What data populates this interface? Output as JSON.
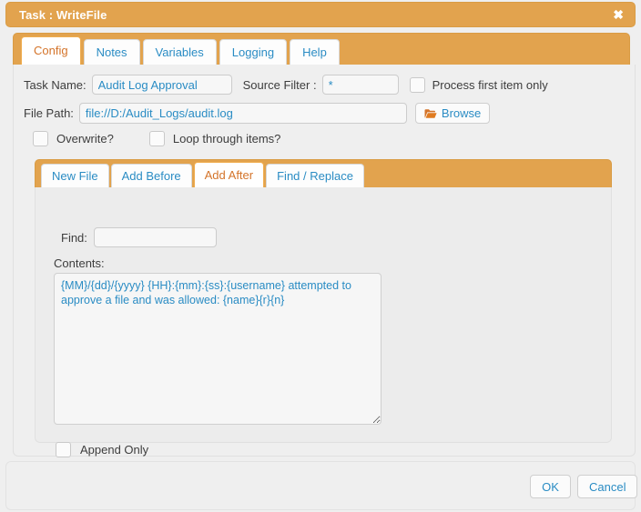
{
  "window": {
    "title": "Task : WriteFile",
    "close_icon": "close-icon",
    "close_glyph": "✖"
  },
  "main_tabs": [
    {
      "label": "Config",
      "active": true
    },
    {
      "label": "Notes",
      "active": false
    },
    {
      "label": "Variables",
      "active": false
    },
    {
      "label": "Logging",
      "active": false
    },
    {
      "label": "Help",
      "active": false
    }
  ],
  "config": {
    "task_name_label": "Task Name:",
    "task_name_value": "Audit Log Approval",
    "source_filter_label": "Source Filter :",
    "source_filter_value": "*",
    "process_first_item_label": "Process first item only",
    "process_first_item_checked": false,
    "file_path_label": "File Path:",
    "file_path_value": "file://D:/Audit_Logs/audit.log",
    "browse_label": "Browse",
    "browse_icon": "folder-open-icon",
    "overwrite_label": "Overwrite?",
    "overwrite_checked": false,
    "loop_label": "Loop through items?",
    "loop_checked": false
  },
  "mode_tabs": [
    {
      "label": "New File",
      "active": false
    },
    {
      "label": "Add Before",
      "active": false
    },
    {
      "label": "Add After",
      "active": true
    },
    {
      "label": "Find / Replace",
      "active": false
    }
  ],
  "editor": {
    "find_label": "Find:",
    "find_value": "",
    "contents_label": "Contents:",
    "contents_value": "{MM}/{dd}/{yyyy} {HH}:{mm}:{ss}:{username} attempted to approve a file and was allowed: {name}{r}{n}",
    "append_only_label": "Append Only",
    "append_only_checked": false
  },
  "footer": {
    "ok_label": "OK",
    "cancel_label": "Cancel"
  },
  "colors": {
    "accent_orange": "#e2a34e",
    "active_tab_text": "#d4742a",
    "link_blue": "#2a8cc4",
    "page_bg": "#efefef"
  }
}
